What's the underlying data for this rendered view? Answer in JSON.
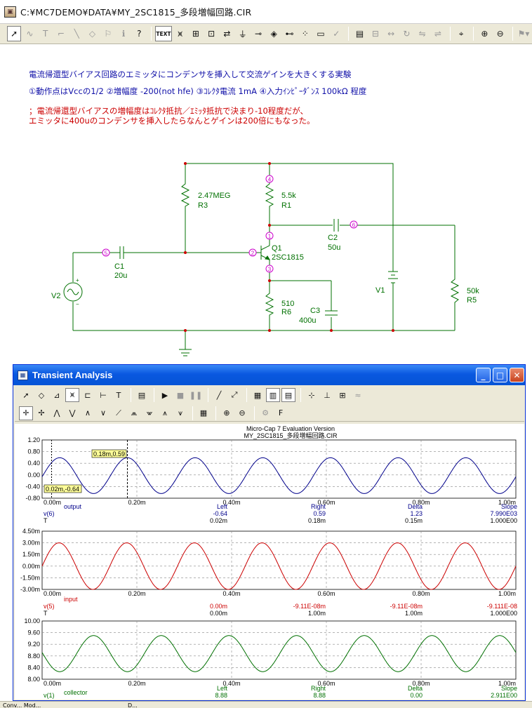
{
  "window": {
    "title": "C:¥MC7DEMO¥DATA¥MY_2SC1815_多段増幅回路.CIR"
  },
  "toolbar": {
    "text_button": "TEXT"
  },
  "notes": {
    "line1": "電流帰還型バイアス回路のエミッタにコンデンサを挿入して交流ゲインを大きくする実験",
    "line2": "①動作点はVccの1/2 ②増幅度 -200(not hfe) ③ｺﾚｸﾀ電流 1mA ④入力ｲﾝﾋﾟｰﾀﾞﾝｽ 100kΩ 程度",
    "line3": "；電流帰還型バイアスの増幅度はｺﾚｸﾀ抵抗／ｴﾐｯﾀ抵抗で決まり-10程度だが、",
    "line4": "エミッタに400uのコンデンサを挿入したらなんとゲインは200倍にもなった。"
  },
  "schematic": {
    "r3_value": "2.47MEG",
    "r3_name": "R3",
    "r1_value": "5.5k",
    "r1_name": "R1",
    "c2_name": "C2",
    "c2_value": "50u",
    "q1_name": "Q1",
    "q1_model": "2SC1815",
    "c1_name": "C1",
    "c1_value": "20u",
    "v2_name": "V2",
    "r6_value": "510",
    "r6_name": "R6",
    "c3_name": "C3",
    "c3_value": "400u",
    "v1_name": "V1",
    "r5_value": "50k",
    "r5_name": "R5",
    "node1": "1",
    "node2": "2",
    "node3": "3",
    "node4": "4",
    "node5": "5",
    "node6": "6"
  },
  "analysis_window": {
    "title": "Transient Analysis",
    "minimize": "_",
    "maximize": "□",
    "close": "✕"
  },
  "plot": {
    "header1": "Micro-Cap 7 Evaluation Version",
    "header2": "MY_2SC1815_多段増幅回路.CIR",
    "x_ticks": [
      "0.00m",
      "0.20m",
      "0.40m",
      "0.60m",
      "0.80m",
      "1.00m"
    ],
    "panel1": {
      "y_ticks": [
        "1.20",
        "0.80",
        "0.40",
        "0.00",
        "-0.40",
        "-0.80"
      ],
      "trace_label": "output",
      "cursor_left_tag": "0.02m,-0.64",
      "cursor_right_tag": "0.18m,0.59",
      "table": {
        "h_left": "Left",
        "h_right": "Right",
        "h_delta": "Delta",
        "h_slope": "Slope",
        "r1_name": "v(6)",
        "r1_left": "-0.64",
        "r1_right": "0.59",
        "r1_delta": "1.23",
        "r1_slope": "7.990E03",
        "r2_name": "T",
        "r2_left": "0.02m",
        "r2_right": "0.18m",
        "r2_delta": "0.15m",
        "r2_slope": "1.000E00"
      }
    },
    "panel2": {
      "y_ticks": [
        "4.50m",
        "3.00m",
        "1.50m",
        "0.00m",
        "-1.50m",
        "-3.00m"
      ],
      "trace_label": "input",
      "table": {
        "r1_name": "v(5)",
        "r1_left": "0.00m",
        "r1_right": "-9.11E-08m",
        "r1_delta": "-9.11E-08m",
        "r1_slope": "-9.111E-08",
        "r2_name": "T",
        "r2_left": "0.00m",
        "r2_right": "1.00m",
        "r2_delta": "1.00m",
        "r2_slope": "1.000E00"
      }
    },
    "panel3": {
      "y_ticks": [
        "10.00",
        "9.60",
        "9.20",
        "8.80",
        "8.40",
        "8.00"
      ],
      "trace_label": "collector",
      "table": {
        "h_left": "Left",
        "h_right": "Right",
        "h_delta": "Delta",
        "h_slope": "Slope",
        "r1_name": "v(1)",
        "r1_left": "8.88",
        "r1_right": "8.88",
        "r1_delta": "0.00",
        "r1_slope": "2.911E00"
      }
    }
  },
  "status": {
    "left": "Conv... Mod...",
    "right": "D..."
  },
  "chart_data": [
    {
      "type": "line",
      "series": [
        {
          "name": "output",
          "expr": "v(6)",
          "amplitude": 0.615,
          "offset": -0.025,
          "frequency_hz": 7000,
          "phase_note": "peak near 0.18m"
        }
      ],
      "x_range": [
        0,
        1.0
      ],
      "x_unit": "ms",
      "ylim": [
        -0.8,
        1.2
      ],
      "color": "#00008b"
    },
    {
      "type": "line",
      "series": [
        {
          "name": "input",
          "expr": "v(5)",
          "amplitude": 3.0,
          "offset": 0.0,
          "frequency_hz": 7000,
          "unit": "mV"
        }
      ],
      "x_range": [
        0,
        1.0
      ],
      "x_unit": "ms",
      "ylim": [
        -3.0,
        4.5
      ],
      "color": "#cc0000"
    },
    {
      "type": "line",
      "series": [
        {
          "name": "collector",
          "expr": "v(1)",
          "amplitude": 0.62,
          "offset": 8.88,
          "frequency_hz": 7000
        }
      ],
      "x_range": [
        0,
        1.0
      ],
      "x_unit": "ms",
      "ylim": [
        8.0,
        10.0
      ],
      "color": "#007000"
    }
  ],
  "colors": {
    "wire": "#007000",
    "node": "#cc00cc",
    "junction": "#cc0000",
    "note_blue": "#1010a8",
    "note_red": "#cc0000",
    "titlebar_blue": "#0554d6"
  }
}
